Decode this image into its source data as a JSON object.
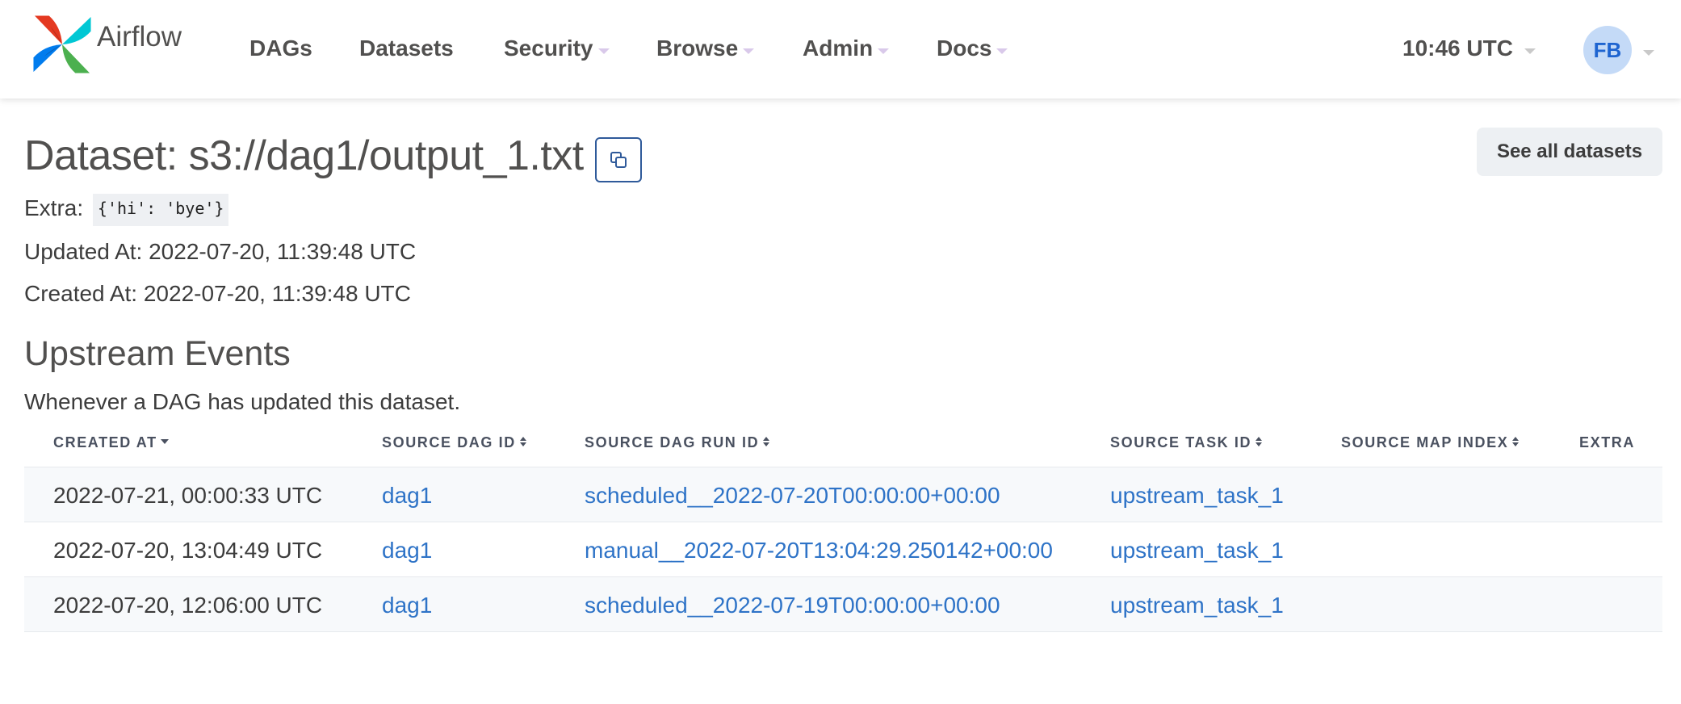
{
  "nav": {
    "brand": "Airflow",
    "items": [
      {
        "label": "DAGs"
      },
      {
        "label": "Datasets"
      },
      {
        "label": "Security"
      },
      {
        "label": "Browse"
      },
      {
        "label": "Admin"
      },
      {
        "label": "Docs"
      }
    ],
    "clock": "10:46 UTC",
    "user_initials": "FB"
  },
  "dataset": {
    "title": "Dataset: s3://dag1/output_1.txt",
    "see_all_label": "See all datasets",
    "extra_label": "Extra:",
    "extra_value": "{'hi': 'bye'}",
    "updated_at": "Updated At: 2022-07-20, 11:39:48 UTC",
    "created_at": "Created At: 2022-07-20, 11:39:48 UTC"
  },
  "upstream": {
    "title": "Upstream Events",
    "subtitle": "Whenever a DAG has updated this dataset.",
    "columns": [
      "Created At",
      "Source DAG ID",
      "Source DAG Run ID",
      "Source Task ID",
      "Source Map Index",
      "Extra"
    ],
    "rows": [
      {
        "created_at": "2022-07-21, 00:00:33 UTC",
        "dag_id": "dag1",
        "run_id": "scheduled__2022-07-20T00:00:00+00:00",
        "task_id": "upstream_task_1",
        "map_index": "",
        "extra": ""
      },
      {
        "created_at": "2022-07-20, 13:04:49 UTC",
        "dag_id": "dag1",
        "run_id": "manual__2022-07-20T13:04:29.250142+00:00",
        "task_id": "upstream_task_1",
        "map_index": "",
        "extra": ""
      },
      {
        "created_at": "2022-07-20, 12:06:00 UTC",
        "dag_id": "dag1",
        "run_id": "scheduled__2022-07-19T00:00:00+00:00",
        "task_id": "upstream_task_1",
        "map_index": "",
        "extra": ""
      }
    ]
  },
  "colors": {
    "link": "#2e73c7",
    "avatar_bg": "#c4daf7",
    "avatar_fg": "#1e64d0",
    "row_stripe": "#f7f9fb"
  },
  "icons": {
    "logo": "airflow-pinwheel-logo",
    "copy": "copy-icon"
  }
}
